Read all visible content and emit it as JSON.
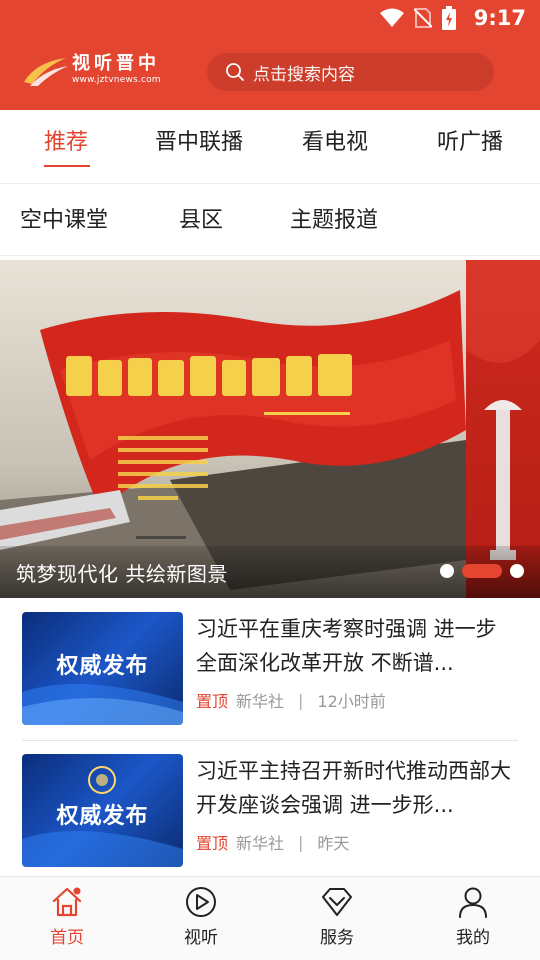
{
  "status": {
    "time": "9:17"
  },
  "header": {
    "logo_title": "视听晋中",
    "logo_url": "www.jztvnews.com",
    "search_placeholder": "点击搜索内容"
  },
  "tabs": [
    {
      "label": "推荐",
      "active": true
    },
    {
      "label": "晋中联播",
      "active": false
    },
    {
      "label": "看电视",
      "active": false
    },
    {
      "label": "听广播",
      "active": false
    }
  ],
  "subtabs": [
    {
      "label": "空中课堂"
    },
    {
      "label": "县区"
    },
    {
      "label": "主题报道"
    }
  ],
  "banner": {
    "caption": "筑梦现代化  共绘新图景",
    "slide_count": 3,
    "active_slide": 2
  },
  "news": [
    {
      "thumb_label": "权威发布",
      "title": "习近平在重庆考察时强调  进一步全面深化改革开放  不断谱...",
      "badge": "置顶",
      "source": "新华社",
      "separator": "|",
      "time": "12小时前"
    },
    {
      "thumb_label": "权威发布",
      "title": "习近平主持召开新时代推动西部大开发座谈会强调  进一步形...",
      "badge": "置顶",
      "source": "新华社",
      "separator": "|",
      "time": "昨天"
    }
  ],
  "bottomnav": [
    {
      "label": "首页",
      "icon": "home-icon",
      "active": true
    },
    {
      "label": "视听",
      "icon": "play-icon",
      "active": false
    },
    {
      "label": "服务",
      "icon": "diamond-icon",
      "active": false
    },
    {
      "label": "我的",
      "icon": "user-icon",
      "active": false
    }
  ],
  "colors": {
    "brand": "#e44530",
    "text": "#222222",
    "muted": "#999999"
  }
}
